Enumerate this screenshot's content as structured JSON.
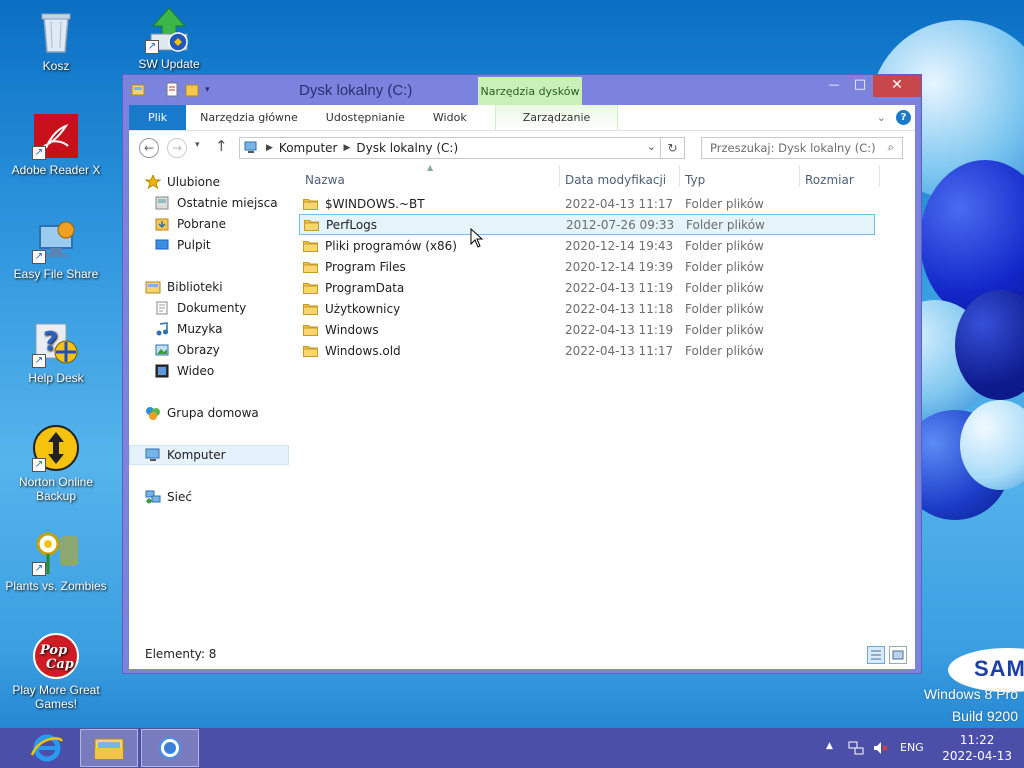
{
  "desktop": {
    "icons": [
      {
        "label": "Kosz"
      },
      {
        "label": "SW Update"
      },
      {
        "label": "Adobe Reader X"
      },
      {
        "label": "Easy File Share"
      },
      {
        "label": "Help Desk"
      },
      {
        "label": "Norton Online Backup"
      },
      {
        "label": "Plants vs. Zombies"
      },
      {
        "label": "Play More Great Games!"
      }
    ],
    "os_line1": "Windows 8 Pro",
    "os_line2": "Build 9200",
    "brand": "SAM"
  },
  "window": {
    "title": "Dysk lokalny (C:)",
    "context_tab_group": "Narzędzia dysków",
    "ribbon_tabs": [
      "Plik",
      "Narzędzia główne",
      "Udostępnianie",
      "Widok",
      "Zarządzanie"
    ],
    "minimize": "—",
    "maximize": "□",
    "close": "✕",
    "help": "?",
    "address": [
      "Komputer",
      "Dysk lokalny (C:)"
    ],
    "search_placeholder": "Przeszukaj: Dysk lokalny (C:)",
    "nav": {
      "favorites": "Ulubione",
      "favorites_items": [
        "Ostatnie miejsca",
        "Pobrane",
        "Pulpit"
      ],
      "libraries": "Biblioteki",
      "libraries_items": [
        "Dokumenty",
        "Muzyka",
        "Obrazy",
        "Wideo"
      ],
      "homegroup": "Grupa domowa",
      "computer": "Komputer",
      "network": "Sieć"
    },
    "columns": {
      "name": "Nazwa",
      "date": "Data modyfikacji",
      "type": "Typ",
      "size": "Rozmiar"
    },
    "files": [
      {
        "name": "$WINDOWS.~BT",
        "date": "2022-04-13 11:17",
        "type": "Folder plików"
      },
      {
        "name": "PerfLogs",
        "date": "2012-07-26 09:33",
        "type": "Folder plików"
      },
      {
        "name": "Pliki programów (x86)",
        "date": "2020-12-14 19:43",
        "type": "Folder plików"
      },
      {
        "name": "Program Files",
        "date": "2020-12-14 19:39",
        "type": "Folder plików"
      },
      {
        "name": "ProgramData",
        "date": "2022-04-13 11:19",
        "type": "Folder plików"
      },
      {
        "name": "Użytkownicy",
        "date": "2022-04-13 11:18",
        "type": "Folder plików"
      },
      {
        "name": "Windows",
        "date": "2022-04-13 11:19",
        "type": "Folder plików"
      },
      {
        "name": "Windows.old",
        "date": "2022-04-13 11:17",
        "type": "Folder plików"
      }
    ],
    "status": "Elementy: 8"
  },
  "taskbar": {
    "language": "ENG",
    "time": "11:22",
    "date": "2022-04-13"
  },
  "colors": {
    "accent": "#1979ca",
    "window_frame": "#7b83de",
    "context_tab": "#c8f0b8",
    "close": "#c7474a"
  }
}
